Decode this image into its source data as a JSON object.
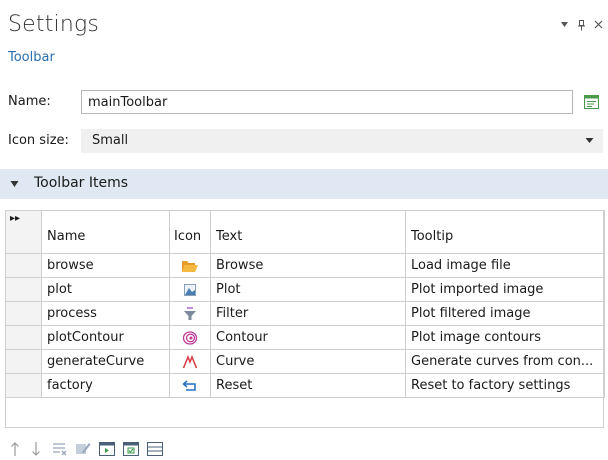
{
  "panel": {
    "title": "Settings",
    "subtitle": "Toolbar",
    "controls": [
      "dropdown-icon",
      "pin-icon",
      "close-icon"
    ]
  },
  "form": {
    "name_label": "Name:",
    "name_value": "mainToolbar",
    "icon_size_label": "Icon size:",
    "icon_size_value": "Small"
  },
  "section": {
    "title": "Toolbar Items"
  },
  "table": {
    "headers": {
      "selector": "▸▸",
      "name": "Name",
      "icon": "Icon",
      "text": "Text",
      "tooltip": "Tooltip"
    },
    "rows": [
      {
        "name": "browse",
        "icon": "folder-icon",
        "text": "Browse",
        "tooltip": "Load image file"
      },
      {
        "name": "plot",
        "icon": "image-plot-icon",
        "text": "Plot",
        "tooltip": "Plot imported image"
      },
      {
        "name": "process",
        "icon": "filter-icon",
        "text": "Filter",
        "tooltip": "Plot filtered image"
      },
      {
        "name": "plotContour",
        "icon": "contour-icon",
        "text": "Contour",
        "tooltip": "Plot image contours"
      },
      {
        "name": "generateCurve",
        "icon": "curve-icon",
        "text": "Curve",
        "tooltip": "Generate curves from con..."
      },
      {
        "name": "factory",
        "icon": "reset-icon",
        "text": "Reset",
        "tooltip": "Reset to factory settings"
      }
    ]
  },
  "colors": {
    "accent": "#2a6fb0",
    "section_bg": "#dfe8f3",
    "select_bg": "#f0f0f0"
  },
  "bottom_toolbar": [
    "move-up-icon",
    "move-down-icon",
    "delete-list-icon",
    "edit-icon",
    "add-item-icon",
    "add-checked-icon",
    "layout-icon"
  ]
}
